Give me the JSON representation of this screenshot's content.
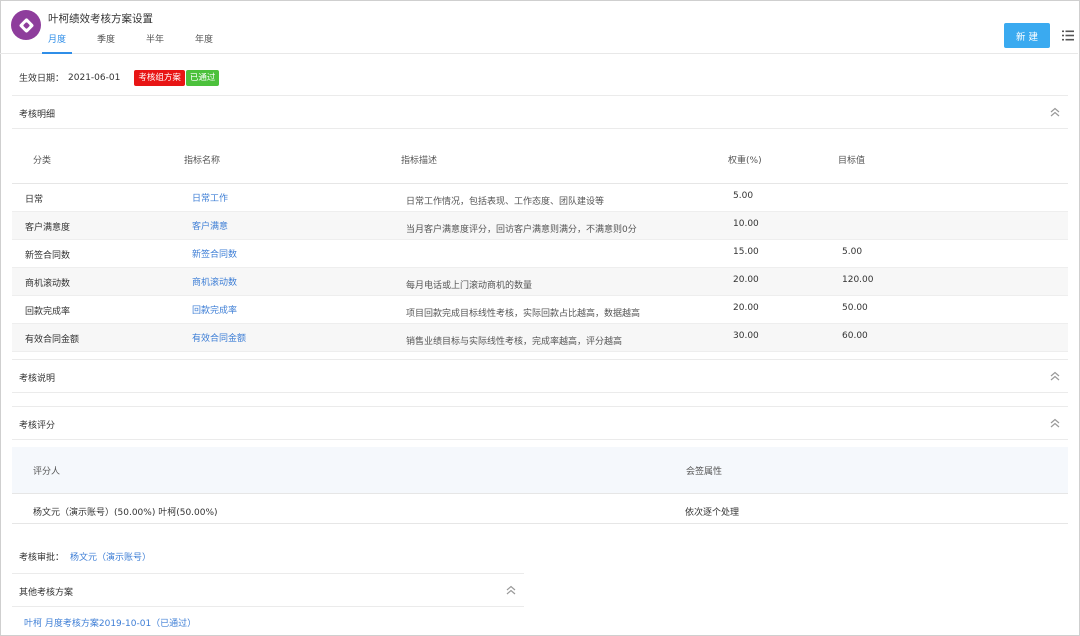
{
  "header": {
    "title": "叶柯绩效考核方案设置",
    "tabs": [
      {
        "label": "月度",
        "active": true
      },
      {
        "label": "季度",
        "active": false
      },
      {
        "label": "半年",
        "active": false
      },
      {
        "label": "年度",
        "active": false
      }
    ],
    "new_button_label": "新 建",
    "list_icon": "list-icon",
    "logo_icon": "diamond-logo-icon"
  },
  "effective": {
    "label": "生效日期：",
    "date": "2021-06-01",
    "badge_scheme": "考核组方案",
    "badge_status": "已通过"
  },
  "detail_section": {
    "title": "考核明细",
    "columns": [
      "分类",
      "指标名称",
      "指标描述",
      "权重(%)",
      "目标值"
    ],
    "rows": [
      {
        "category": "日常",
        "name": "日常工作",
        "description": "日常工作情况，包括表现、工作态度、团队建设等",
        "weight": "5.00",
        "target": ""
      },
      {
        "category": "客户满意度",
        "name": "客户满意",
        "description": "当月客户满意度评分，回访客户满意则满分，不满意则0分",
        "weight": "10.00",
        "target": ""
      },
      {
        "category": "新签合同数",
        "name": "新签合同数",
        "description": "",
        "weight": "15.00",
        "target": "5.00"
      },
      {
        "category": "商机滚动数",
        "name": "商机滚动数",
        "description": "每月电话或上门滚动商机的数量",
        "weight": "20.00",
        "target": "120.00"
      },
      {
        "category": "回款完成率",
        "name": "回款完成率",
        "description": "项目回款完成目标线性考核，实际回款占比越高，数据越高",
        "weight": "20.00",
        "target": "50.00"
      },
      {
        "category": "有效合同金额",
        "name": "有效合同金额",
        "description": "销售业绩目标与实际线性考核，完成率越高，评分越高",
        "weight": "30.00",
        "target": "60.00"
      }
    ]
  },
  "explain_section": {
    "title": "考核说明"
  },
  "score_section": {
    "title": "考核评分",
    "columns": [
      "评分人",
      "会签属性"
    ],
    "row": {
      "raters": "杨文元（演示账号）(50.00%)   叶柯(50.00%)",
      "attribute": "依次逐个处理"
    }
  },
  "approval": {
    "label": "考核审批：",
    "value": "杨文元（演示账号）"
  },
  "other_section": {
    "title": "其他考核方案",
    "link": "叶柯 月度考核方案2019-10-01（已通过）"
  },
  "colors": {
    "accent": "#2f8ee8",
    "button": "#3aaaf0",
    "logo": "#8e3d9c",
    "badge_red": "#e81515",
    "badge_green": "#4cc13c",
    "link": "#3f7fd6"
  }
}
